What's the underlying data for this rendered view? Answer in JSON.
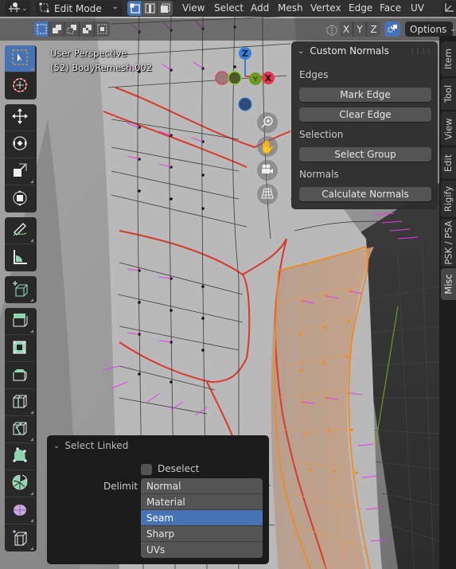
{
  "header": {
    "editor_type_icon": "3d-viewport-icon",
    "mode_label": "Edit Mode",
    "select_modes": [
      "vertex-select",
      "edge-select",
      "face-select"
    ],
    "active_select_mode": "vertex-select",
    "menus": [
      "View",
      "Select",
      "Add",
      "Mesh",
      "Vertex",
      "Edge",
      "Face",
      "UV"
    ]
  },
  "toolrow": {
    "selection_ops": [
      "set-new",
      "extend",
      "subtract",
      "difference",
      "intersect"
    ],
    "mirror_axes": [
      "X",
      "Y",
      "Z"
    ],
    "options_label": "Options"
  },
  "viewport": {
    "view_name": "User Perspective",
    "object_info": "(52) BodyRemesh.002",
    "gizmo_axes": {
      "x": "X",
      "y": "Y",
      "z": "Z"
    },
    "colors": {
      "x_axis": "#e0394f",
      "y_axis": "#6e9a1f",
      "z_axis": "#3a7fd6",
      "normals": "#e23df0",
      "seam": "#d9382b",
      "selected": "#f08a24"
    }
  },
  "toolbar": {
    "tools": [
      {
        "name": "select-box",
        "active": true
      },
      {
        "name": "cursor"
      },
      {
        "name": "move"
      },
      {
        "name": "rotate"
      },
      {
        "name": "scale"
      },
      {
        "name": "transform"
      },
      {
        "name": "annotate"
      },
      {
        "name": "measure"
      },
      {
        "name": "add-cube"
      },
      {
        "name": "extrude-region"
      },
      {
        "name": "inset-faces"
      },
      {
        "name": "bevel"
      },
      {
        "name": "loop-cut"
      },
      {
        "name": "knife"
      },
      {
        "name": "poly-build"
      },
      {
        "name": "spin"
      },
      {
        "name": "smooth"
      },
      {
        "name": "shrink-fatten"
      }
    ]
  },
  "npanel": {
    "title": "Custom Normals",
    "sections": [
      {
        "label": "Edges",
        "buttons": [
          "Mark Edge",
          "Clear Edge"
        ]
      },
      {
        "label": "Selection",
        "buttons": [
          "Select Group"
        ]
      },
      {
        "label": "Normals",
        "buttons": [
          "Calculate Normals"
        ]
      }
    ],
    "tabs": [
      "Item",
      "Tool",
      "View",
      "Edit",
      "Rigify",
      "PSK / PSA",
      "Misc"
    ],
    "active_tab": "Misc"
  },
  "operator_panel": {
    "title": "Select Linked",
    "deselect_label": "Deselect",
    "deselect_checked": false,
    "delimit_label": "Delimit",
    "delimit_options": [
      "Normal",
      "Material",
      "Seam",
      "Sharp",
      "UVs"
    ],
    "delimit_selected": "Seam"
  }
}
